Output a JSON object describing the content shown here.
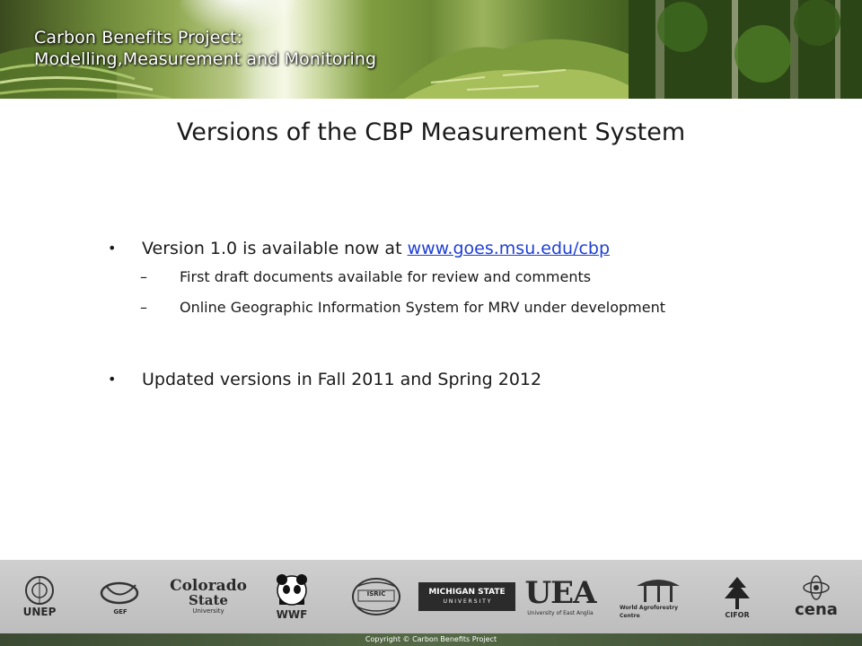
{
  "banner": {
    "title_line1": "Carbon Benefits Project:",
    "title_line2": "Modelling,Measurement and Monitoring"
  },
  "slide": {
    "title": "Versions of the CBP Measurement System",
    "bullet1_text": "Version 1.0 is available now at ",
    "bullet1_link": "www.goes.msu.edu/cbp",
    "sub1": "First draft documents available for review and comments",
    "sub2": "Online Geographic Information System for MRV under development",
    "bullet2_text": "Updated versions in Fall 2011 and Spring 2012"
  },
  "logos": {
    "unep": "UNEP",
    "gef": "GEF",
    "colorado": "Colorado",
    "colorado2": "State",
    "colorado3": "University",
    "wwf": "WWF",
    "isric": "ISRIC",
    "msu1": "MICHIGAN STATE",
    "msu2": "U N I V E R S I T Y",
    "uea": "UEA",
    "uea_sub": "University of East Anglia",
    "agroforestry": "World Agroforestry Centre",
    "cifor": "CIFOR",
    "cena": "cena"
  },
  "footer": {
    "copyright": "Copyright © Carbon Benefits Project"
  },
  "colors": {
    "link": "#1f3fd6",
    "banner_text": "#ffffff",
    "footer_bg": "#c6c6c6"
  }
}
